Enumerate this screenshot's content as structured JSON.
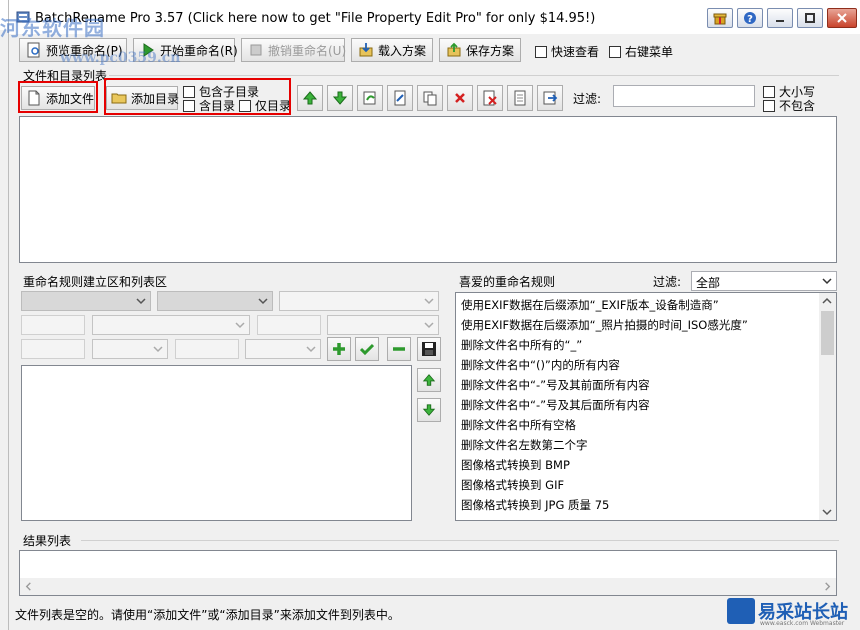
{
  "titlebar": {
    "title": "BatchRename Pro 3.57  (Click here now to get \"File Property Edit Pro\" for only $14.95!)"
  },
  "toolbar": {
    "preview_label": "预览重命名(P)",
    "start_label": "开始重命名(R)",
    "undo_label": "撤销重命名(U)",
    "load_label": "载入方案",
    "save_label": "保存方案",
    "quick_view_label": "快速查看",
    "context_menu_label": "右键菜单"
  },
  "files_section": {
    "title": "文件和目录列表",
    "add_file_label": "添加文件",
    "add_folder_label": "添加目录",
    "include_subfolders_label": "包含子目录",
    "include_folders_label": "含目录",
    "folders_only_label": "仅目录",
    "filter_label": "过滤:",
    "filter_value": "",
    "case_sensitive_label": "大小写",
    "exclude_label": "不包含"
  },
  "rules_section": {
    "title": "重命名规则建立区和列表区"
  },
  "favorites": {
    "title": "喜爱的重命名规则",
    "filter_label": "过滤:",
    "filter_value": "全部",
    "items": [
      "使用EXIF数据在后缀添加“_EXIF版本_设备制造商”",
      "使用EXIF数据在后缀添加“_照片拍摄的时间_ISO感光度”",
      "删除文件名中所有的“_”",
      "删除文件名中“()”内的所有内容",
      "删除文件名中“-”号及其前面所有内容",
      "删除文件名中“-”号及其后面所有内容",
      "删除文件名中所有空格",
      "删除文件名左数第二个字",
      "图像格式转换到 BMP",
      "图像格式转换到 GIF",
      "图像格式转换到 JPG 质量 75"
    ]
  },
  "results_section": {
    "title": "结果列表"
  },
  "status": {
    "text": "文件列表是空的。请使用“添加文件”或“添加目录”来添加文件到列表中。"
  },
  "watermarks": {
    "top_site": "河东软件园",
    "top_url": "www.pc0359.cn",
    "bottom_site": "易采站长站",
    "bottom_url": "www.easck.com  Webmaster"
  },
  "colors": {
    "highlight_red": "#e60000",
    "window_bg": "#f0f0f0",
    "icon_green": "#2e9a2e",
    "icon_red": "#d42020"
  }
}
